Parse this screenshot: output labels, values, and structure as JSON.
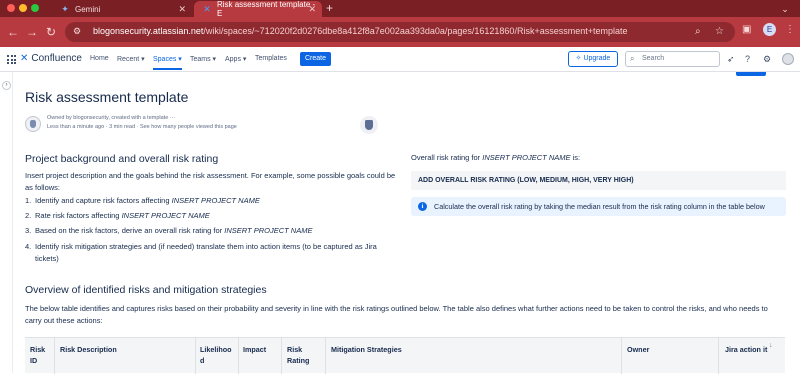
{
  "browser": {
    "tabs": [
      {
        "title": "Gemini",
        "icon": "gemini-sparkle-icon"
      },
      {
        "title": "Risk assessment template - E",
        "icon": "confluence-icon"
      }
    ],
    "url_host": "blogonsecurity.atlassian.net",
    "url_path": "/wiki/spaces/~712020f2d0276dbe8a412f8a7e002aa393da0a/pages/16121860/Risk+assessment+template",
    "profile_initial": "E",
    "accent_color": "#b73a40"
  },
  "nav": {
    "brand": "Confluence",
    "items": [
      "Home",
      "Recent ▾",
      "Spaces ▾",
      "Teams ▾",
      "Apps ▾",
      "Templates"
    ],
    "active_item": "Spaces ▾",
    "create_label": "Create",
    "upgrade_label": "Upgrade",
    "search_placeholder": "Search"
  },
  "page": {
    "title": "Risk assessment template",
    "byline_owner": "Owned by blogonsecurity, created with a template",
    "byline_meta": "Less than a minute ago · 3 min read · See how many people viewed this page",
    "section1_heading": "Project background and overall risk rating",
    "section1_intro": "Insert project description and the goals behind the risk assessment. For example, some possible goals could be as follows:",
    "steps": [
      {
        "n": "1.",
        "text": "Identify and capture risk factors affecting ",
        "em": "INSERT PROJECT NAME"
      },
      {
        "n": "2.",
        "text": "Rate risk factors affecting ",
        "em": "INSERT PROJECT NAME"
      },
      {
        "n": "3.",
        "text": "Based on the risk factors, derive an overall risk rating for ",
        "em": "INSERT PROJECT NAME"
      },
      {
        "n": "4.",
        "text": "Identify risk mitigation strategies and (if needed) translate them into action items (to be captured as Jira tickets)",
        "em": ""
      }
    ],
    "rating_label_prefix": "Overall risk rating for ",
    "rating_label_em": "INSERT PROJECT NAME",
    "rating_label_suffix": " is:",
    "rating_value": "ADD OVERALL RISK RATING (LOW, MEDIUM, HIGH, VERY HIGH)",
    "info_text": "Calculate the overall risk rating by taking the median result from the risk rating column in the table below",
    "section2_heading": "Overview of identified risks and mitigation strategies",
    "section2_intro": "The below table identifies and captures risks based on their probability and severity in line with the risk ratings outlined below. The table also defines what further actions need to be taken to control the risks, and who needs to carry out these actions:",
    "table_headers": [
      "Risk ID",
      "Risk Description",
      "Likelihoo d",
      "Impact",
      "Risk Rating",
      "Mitigation Strategies",
      "Owner",
      "Jira action it"
    ]
  }
}
